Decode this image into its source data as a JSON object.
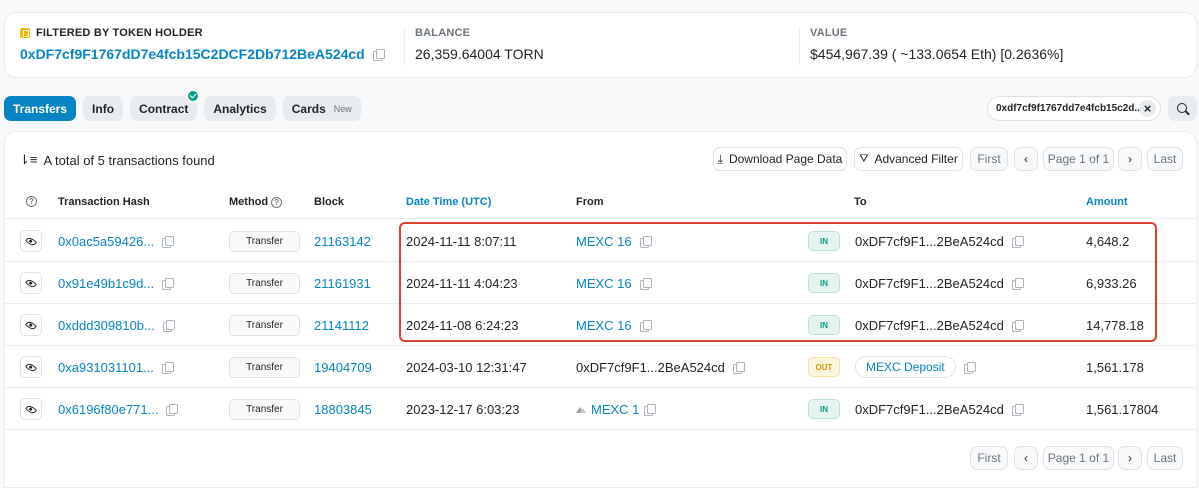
{
  "summary": {
    "filtered_label": "FILTERED BY TOKEN HOLDER",
    "holder_address": "0xDF7cf9F1767dD7e4fcb15C2DCF2Db712BeA524cd",
    "balance_label": "BALANCE",
    "balance_value": "26,359.64004 TORN",
    "value_label": "VALUE",
    "value_value": "$454,967.39 ( ~133.0654 Eth) [0.2636%]"
  },
  "tabs": [
    {
      "label": "Transfers",
      "active": true
    },
    {
      "label": "Info"
    },
    {
      "label": "Contract",
      "verified": true
    },
    {
      "label": "Analytics"
    },
    {
      "label": "Cards",
      "badge": "New"
    }
  ],
  "filter": {
    "address": "0xdf7cf9f1767dd7e4fcb15c2d...",
    "close": "×"
  },
  "toolbar": {
    "total_text": "A total of 5 transactions found",
    "download": "Download Page Data",
    "advanced_filter": "Advanced Filter",
    "first": "First",
    "prev": "‹",
    "page": "Page 1 of 1",
    "next": "›",
    "last": "Last"
  },
  "columns": {
    "hash": "Transaction Hash",
    "method": "Method",
    "block": "Block",
    "datetime": "Date Time (UTC)",
    "from": "From",
    "to": "To",
    "amount": "Amount"
  },
  "rows": [
    {
      "hash": "0x0ac5a59426...",
      "method": "Transfer",
      "block": "21163142",
      "datetime": "2024-11-11 8:07:11",
      "from": "MEXC 16",
      "dir": "IN",
      "to": "0xDF7cf9F1...2BeA524cd",
      "amount": "4,648.2"
    },
    {
      "hash": "0x91e49b1c9d...",
      "method": "Transfer",
      "block": "21161931",
      "datetime": "2024-11-11 4:04:23",
      "from": "MEXC 16",
      "dir": "IN",
      "to": "0xDF7cf9F1...2BeA524cd",
      "amount": "6,933.26"
    },
    {
      "hash": "0xddd309810b...",
      "method": "Transfer",
      "block": "21141112",
      "datetime": "2024-11-08 6:24:23",
      "from": "MEXC 16",
      "dir": "IN",
      "to": "0xDF7cf9F1...2BeA524cd",
      "amount": "14,778.18"
    },
    {
      "hash": "0xa931031101...",
      "method": "Transfer",
      "block": "19404709",
      "datetime": "2024-03-10 12:31:47",
      "from": "0xDF7cf9F1...2BeA524cd",
      "dir": "OUT",
      "to": "MEXC Deposit",
      "amount": "1,561.178"
    },
    {
      "hash": "0x6196f80e771...",
      "method": "Transfer",
      "block": "18803845",
      "datetime": "2023-12-17 6:03:23",
      "from": "MEXC 1",
      "dir": "IN",
      "to": "0xDF7cf9F1...2BeA524cd",
      "amount": "1,561.17804"
    }
  ],
  "colors": {
    "accent": "#0784c3",
    "highlight": "#d9412b",
    "in": "#00a186",
    "out": "#cc9a06"
  }
}
